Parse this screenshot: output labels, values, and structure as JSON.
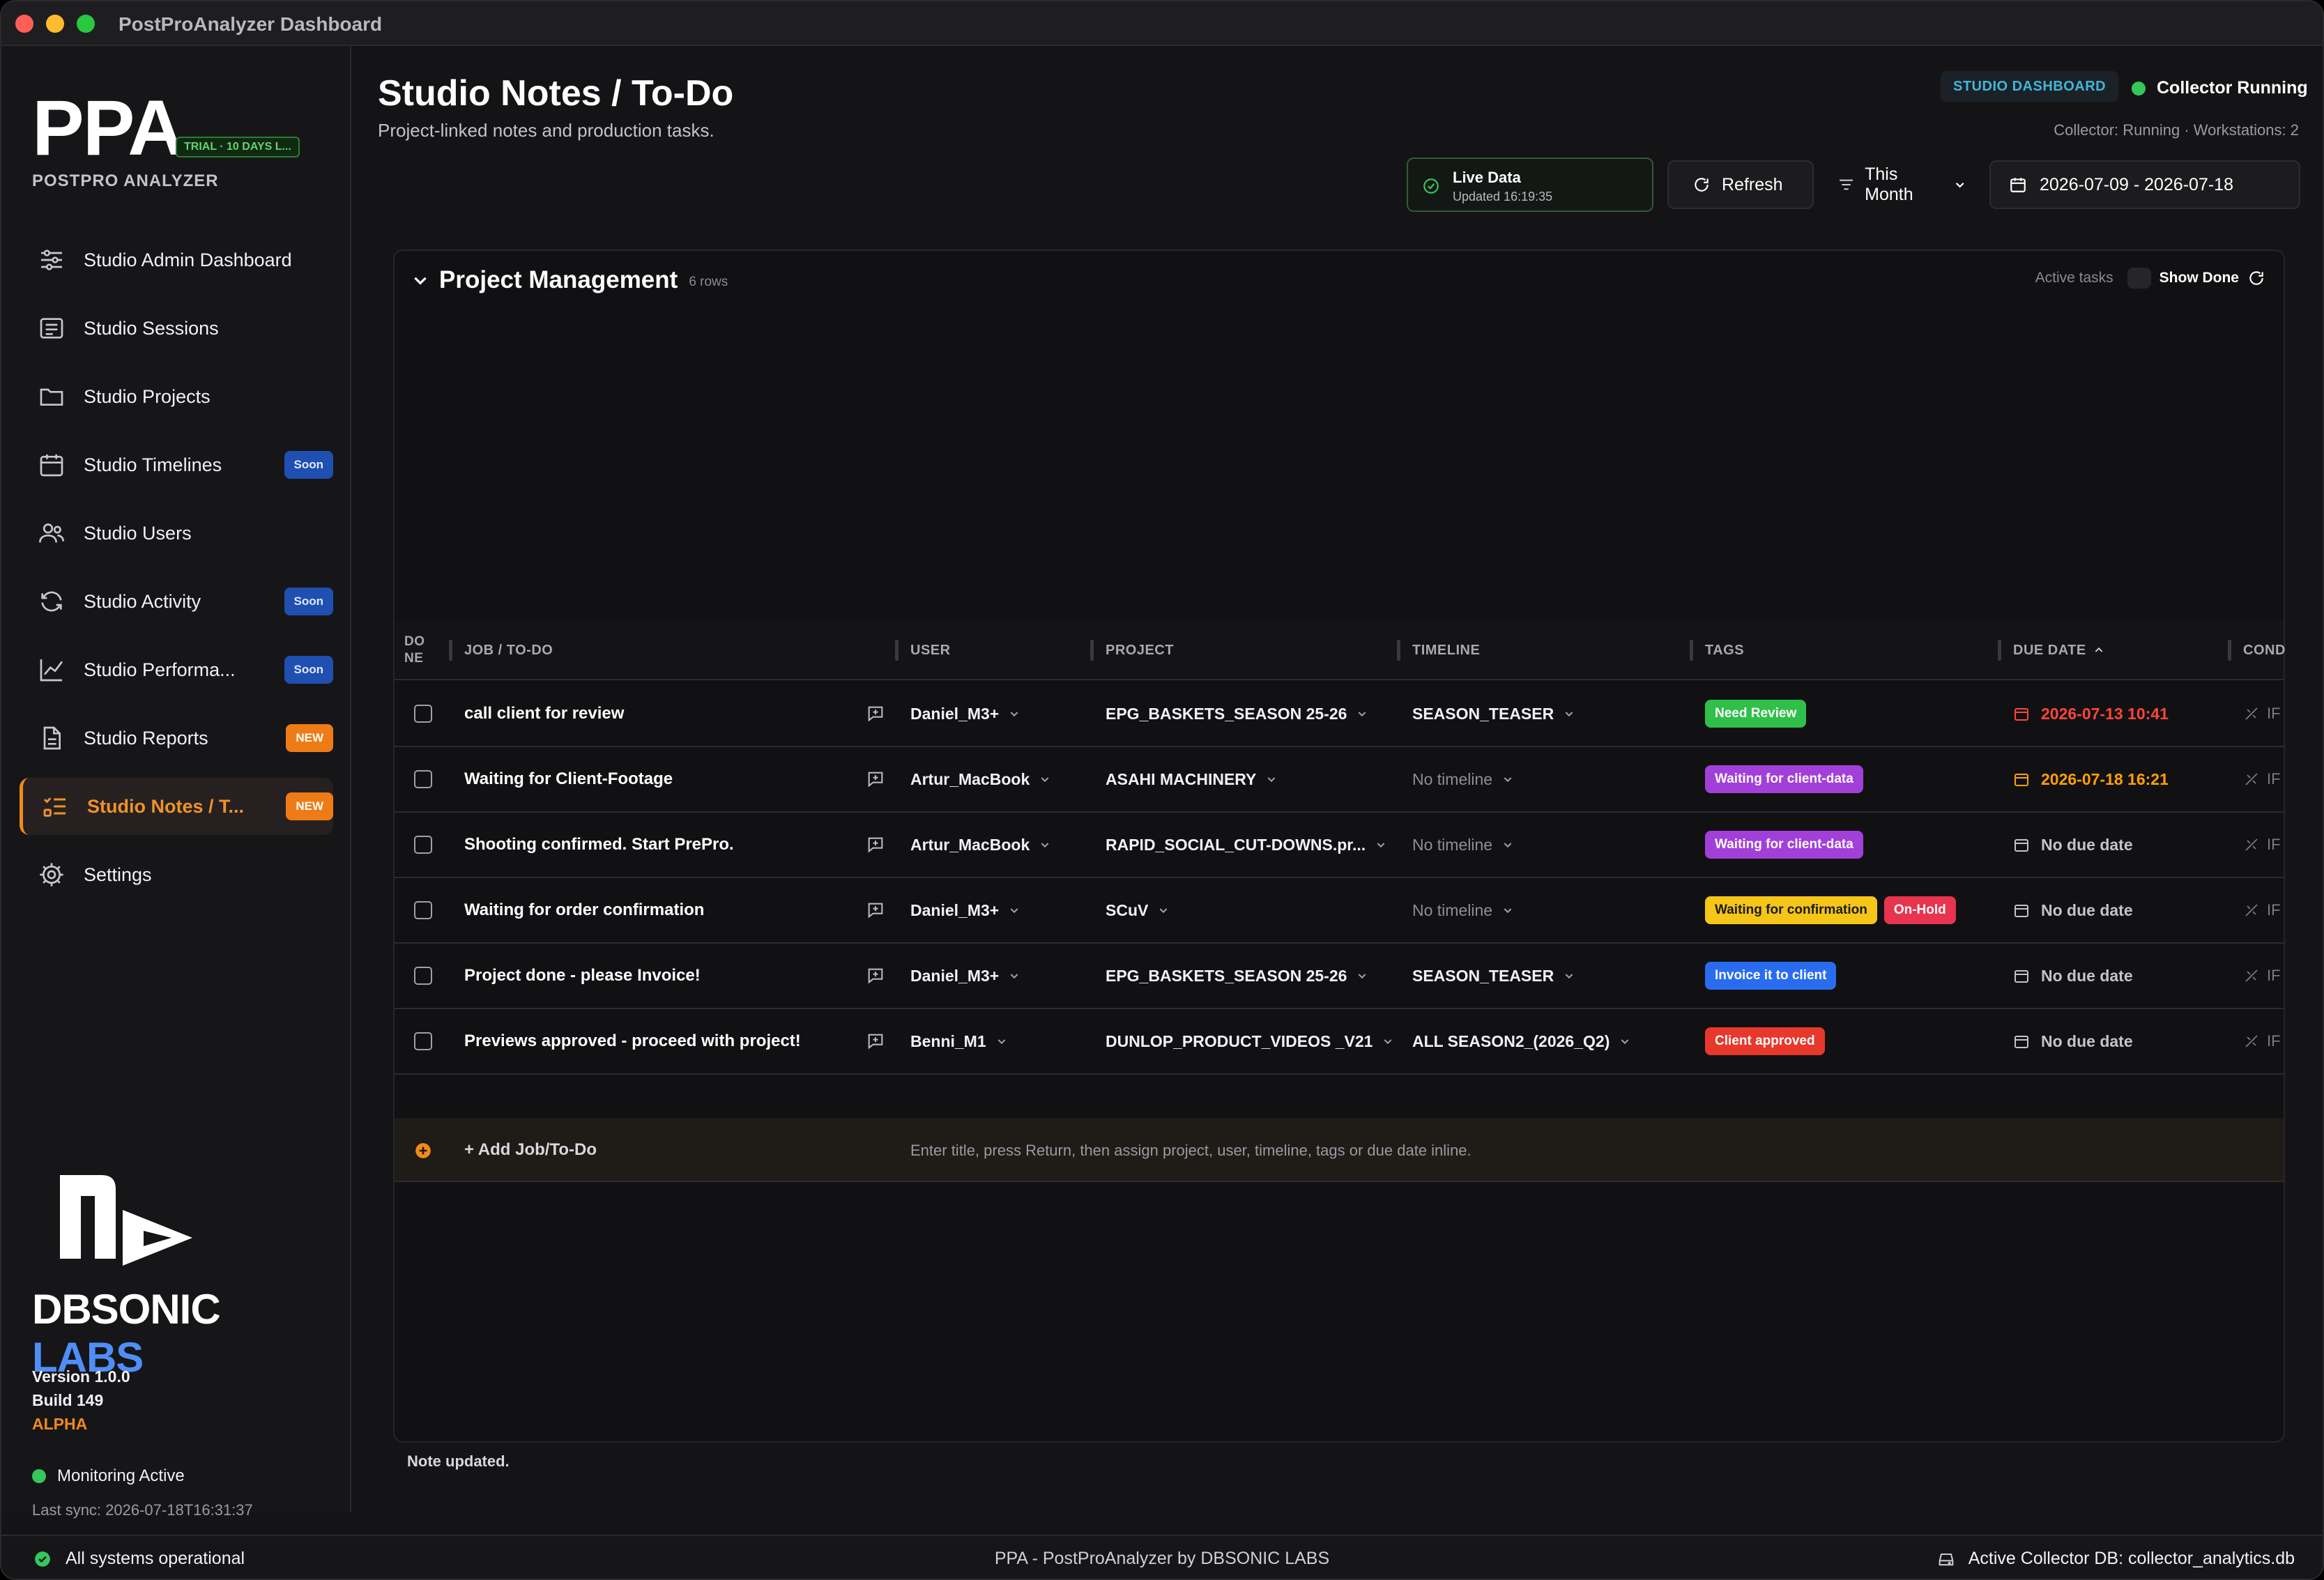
{
  "window": {
    "title": "PostProAnalyzer Dashboard"
  },
  "sidebar": {
    "logo": "PPA",
    "trial": "TRIAL · 10 DAYS L...",
    "subtitle": "POSTPRO ANALYZER",
    "items": [
      {
        "label": "Studio Admin Dashboard",
        "icon": "sliders-icon",
        "badge": ""
      },
      {
        "label": "Studio Sessions",
        "icon": "list-icon",
        "badge": ""
      },
      {
        "label": "Studio Projects",
        "icon": "folder-icon",
        "badge": ""
      },
      {
        "label": "Studio Timelines",
        "icon": "calendar-icon",
        "badge": "Soon"
      },
      {
        "label": "Studio Users",
        "icon": "users-icon",
        "badge": ""
      },
      {
        "label": "Studio Activity",
        "icon": "refresh-icon",
        "badge": "Soon"
      },
      {
        "label": "Studio Performa...",
        "icon": "chart-icon",
        "badge": "Soon"
      },
      {
        "label": "Studio Reports",
        "icon": "document-icon",
        "badge": "NEW"
      },
      {
        "label": "Studio Notes / T...",
        "icon": "checklist-icon",
        "badge": "NEW"
      },
      {
        "label": "Settings",
        "icon": "gear-icon",
        "badge": ""
      }
    ],
    "company": "DBSONIC LABS",
    "version": "Version 1.0.0",
    "build": "Build 149",
    "channel": "ALPHA",
    "monitoring": "Monitoring Active",
    "last_sync": "Last sync: 2026-07-18T16:31:37"
  },
  "header": {
    "title": "Studio Notes / To-Do",
    "subtitle": "Project-linked notes and production tasks.",
    "dashboard_badge": "STUDIO DASHBOARD",
    "collector_status": "Collector Running",
    "collector_detail": "Collector: Running · Workstations: 2",
    "live_title": "Live Data",
    "live_updated": "Updated 16:19:35",
    "refresh_label": "Refresh",
    "period_label": "This Month",
    "date_range": "2026-07-09 - 2026-07-18"
  },
  "panel": {
    "title": "Project Management",
    "rows_count": "6 rows",
    "active_label": "Active tasks",
    "show_done_label": "Show Done"
  },
  "table": {
    "headers": {
      "done": "DO NE",
      "job": "JOB / TO-DO",
      "user": "USER",
      "project": "PROJECT",
      "timeline": "TIMELINE",
      "tags": "TAGS",
      "due": "DUE DATE",
      "cond": "COND"
    },
    "rows": [
      {
        "job": "call client for review",
        "user": "Daniel_M3+",
        "project": "EPG_BASKETS_SEASON 25-26",
        "timeline": "SEASON_TEASER",
        "tags": [
          {
            "label": "Need Review",
            "color": "#2fbf4a"
          }
        ],
        "due": "2026-07-13 10:41",
        "due_state": "red"
      },
      {
        "job": "Waiting for Client-Footage",
        "user": "Artur_MacBook",
        "project": "ASAHI MACHINERY",
        "timeline": "No timeline",
        "tags": [
          {
            "label": "Waiting for client-data",
            "color": "#a23fd8"
          }
        ],
        "due": "2026-07-18 16:21",
        "due_state": "orange"
      },
      {
        "job": "Shooting confirmed. Start PrePro.",
        "user": "Artur_MacBook",
        "project": "RAPID_SOCIAL_CUT-DOWNS.pr...",
        "timeline": "No timeline",
        "tags": [
          {
            "label": "Waiting for client-data",
            "color": "#a23fd8"
          }
        ],
        "due": "No due date",
        "due_state": "none"
      },
      {
        "job": "Waiting for order confirmation",
        "user": "Daniel_M3+",
        "project": "SCuV",
        "timeline": "No timeline",
        "tags": [
          {
            "label": "Waiting for confirmation",
            "color": "#f5c518"
          },
          {
            "label": "On-Hold",
            "color": "#e8344e"
          }
        ],
        "due": "No due date",
        "due_state": "none"
      },
      {
        "job": "Project done - please Invoice!",
        "user": "Daniel_M3+",
        "project": "EPG_BASKETS_SEASON 25-26",
        "timeline": "SEASON_TEASER",
        "tags": [
          {
            "label": "Invoice it to client",
            "color": "#2a6cf0"
          }
        ],
        "due": "No due date",
        "due_state": "none"
      },
      {
        "job": "Previews approved - proceed with project!",
        "user": "Benni_M1",
        "project": "DUNLOP_PRODUCT_VIDEOS _V21",
        "timeline": "ALL SEASON2_(2026_Q2)",
        "tags": [
          {
            "label": "Client approved",
            "color": "#e8382c"
          }
        ],
        "due": "No due date",
        "due_state": "none"
      }
    ],
    "cond_text": "IF",
    "add_label": "+ Add Job/To-Do",
    "add_hint": "Enter title, press Return, then assign project, user, timeline, tags or due date inline."
  },
  "note": "Note updated.",
  "statusbar": {
    "left": "All systems operational",
    "center": "PPA - PostProAnalyzer by DBSONIC LABS",
    "right": "Active Collector DB: collector_analytics.db"
  }
}
